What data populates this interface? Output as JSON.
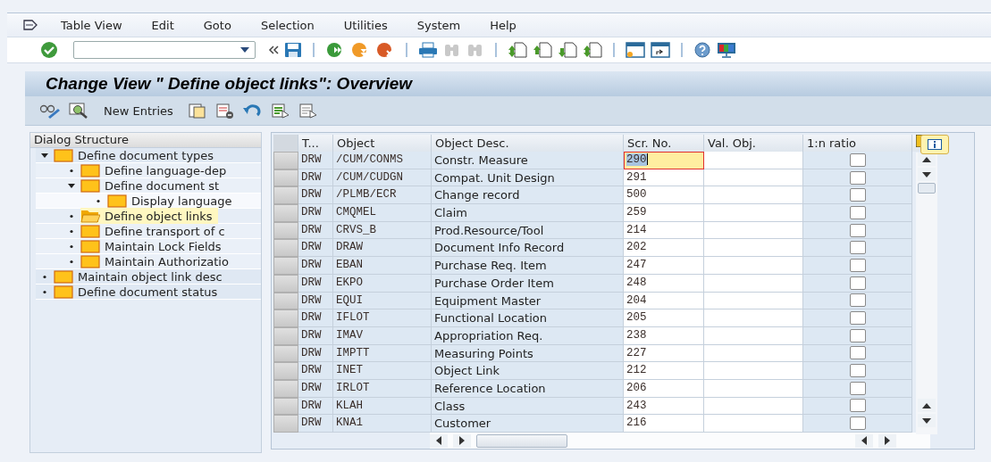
{
  "menu_bar": {
    "items": [
      "Table View",
      "Edit",
      "Goto",
      "Selection",
      "Utilities",
      "System",
      "Help"
    ]
  },
  "title": "Change View \" Define object links\": Overview",
  "app_toolbar": {
    "buttons": [
      {
        "label": "New Entries"
      }
    ]
  },
  "dialog_structure": {
    "title": "Dialog Structure",
    "items": [
      {
        "label": "Define document types",
        "expanded": true,
        "selected": false,
        "children": [
          {
            "label": "Define language-dep",
            "expanded": false,
            "selected": false
          },
          {
            "label": "Define document st",
            "expanded": true,
            "selected": false,
            "children": [
              {
                "label": "Display language",
                "expanded": false,
                "selected": false
              }
            ]
          },
          {
            "label": "Define object links",
            "expanded": false,
            "selected": true
          },
          {
            "label": "Define transport of c",
            "expanded": false,
            "selected": false
          },
          {
            "label": "Maintain Lock Fields",
            "expanded": false,
            "selected": false
          },
          {
            "label": "Maintain Authorizatio",
            "expanded": false,
            "selected": false
          }
        ]
      },
      {
        "label": "Maintain object link desc",
        "expanded": false,
        "selected": false
      },
      {
        "label": "Define document status",
        "expanded": false,
        "selected": false
      }
    ]
  },
  "table": {
    "columns": [
      "T...",
      "Object",
      "Object Desc.",
      "Scr. No.",
      "Val. Obj.",
      "1:n ratio"
    ],
    "rows": [
      {
        "type": "DRW",
        "object": "/CUM/CONMS",
        "description": "Constr. Measure",
        "scr_no": "290",
        "scr_no_focused": true,
        "ratio_checked": false,
        "selected": false
      },
      {
        "type": "DRW",
        "object": "/CUM/CUDGN",
        "description": "Compat. Unit Design",
        "scr_no": "291",
        "scr_no_focused": false,
        "ratio_checked": false,
        "selected": false
      },
      {
        "type": "DRW",
        "object": "/PLMB/ECR",
        "description": "Change record",
        "scr_no": "500",
        "scr_no_focused": false,
        "ratio_checked": false,
        "selected": false
      },
      {
        "type": "DRW",
        "object": "CMQMEL",
        "description": "Claim",
        "scr_no": "259",
        "scr_no_focused": false,
        "ratio_checked": false,
        "selected": false
      },
      {
        "type": "DRW",
        "object": "CRVS_B",
        "description": "Prod.Resource/Tool",
        "scr_no": "214",
        "scr_no_focused": false,
        "ratio_checked": false,
        "selected": false
      },
      {
        "type": "DRW",
        "object": "DRAW",
        "description": "Document Info Record",
        "scr_no": "202",
        "scr_no_focused": false,
        "ratio_checked": false,
        "selected": false
      },
      {
        "type": "DRW",
        "object": "EBAN",
        "description": "Purchase Req. Item",
        "scr_no": "247",
        "scr_no_focused": false,
        "ratio_checked": false,
        "selected": false
      },
      {
        "type": "DRW",
        "object": "EKPO",
        "description": "Purchase Order Item",
        "scr_no": "248",
        "scr_no_focused": false,
        "ratio_checked": false,
        "selected": false
      },
      {
        "type": "DRW",
        "object": "EQUI",
        "description": "Equipment Master",
        "scr_no": "204",
        "scr_no_focused": false,
        "ratio_checked": false,
        "selected": false
      },
      {
        "type": "DRW",
        "object": "IFLOT",
        "description": "Functional Location",
        "scr_no": "205",
        "scr_no_focused": false,
        "ratio_checked": false,
        "selected": false
      },
      {
        "type": "DRW",
        "object": "IMAV",
        "description": "Appropriation Req.",
        "scr_no": "238",
        "scr_no_focused": false,
        "ratio_checked": false,
        "selected": false
      },
      {
        "type": "DRW",
        "object": "IMPTT",
        "description": "Measuring Points",
        "scr_no": "227",
        "scr_no_focused": false,
        "ratio_checked": false,
        "selected": false
      },
      {
        "type": "DRW",
        "object": "INET",
        "description": "Object Link",
        "scr_no": "212",
        "scr_no_focused": false,
        "ratio_checked": false,
        "selected": false
      },
      {
        "type": "DRW",
        "object": "IRLOT",
        "description": "Reference Location",
        "scr_no": "206",
        "scr_no_focused": false,
        "ratio_checked": false,
        "selected": false
      },
      {
        "type": "DRW",
        "object": "KLAH",
        "description": "Class",
        "scr_no": "243",
        "scr_no_focused": false,
        "ratio_checked": false,
        "selected": false
      },
      {
        "type": "DRW",
        "object": "KNA1",
        "description": "Customer",
        "scr_no": "216",
        "scr_no_focused": false,
        "ratio_checked": false,
        "selected": false
      }
    ]
  }
}
